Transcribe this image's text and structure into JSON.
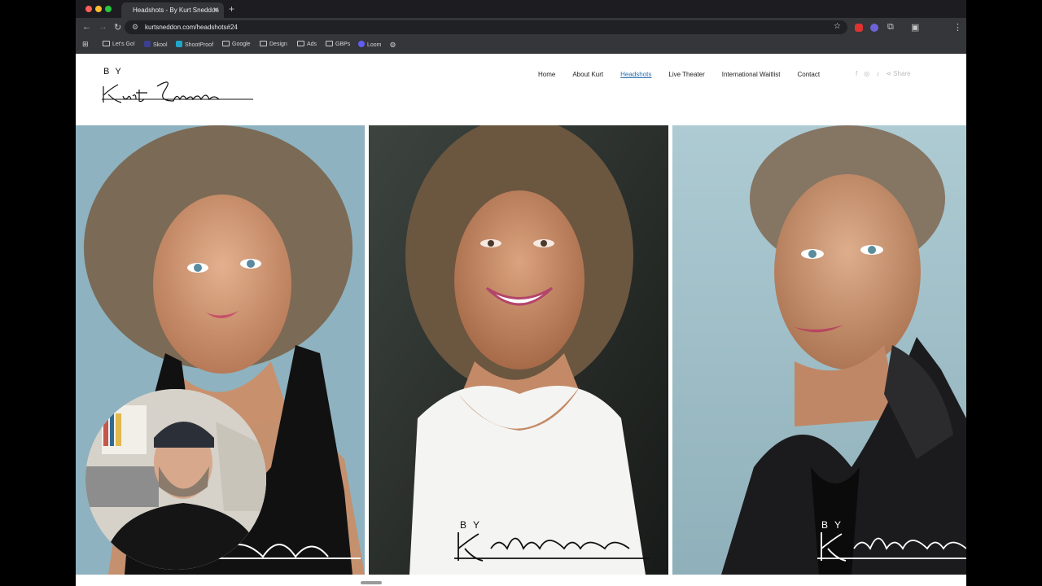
{
  "browser": {
    "tab_title": "Headshots - By Kurt Sneddon",
    "tab_close": "✕",
    "new_tab": "+",
    "url": "kurtsneddon.com/headshots#24",
    "bookmarks": [
      {
        "label": "Let's Go!",
        "type": "folder"
      },
      {
        "label": "Skool",
        "type": "site",
        "color": "#3b3f8f"
      },
      {
        "label": "ShootProof",
        "type": "site",
        "color": "#1fa7c9"
      },
      {
        "label": "Google",
        "type": "folder"
      },
      {
        "label": "Design",
        "type": "folder"
      },
      {
        "label": "Ads",
        "type": "folder"
      },
      {
        "label": "GBPs",
        "type": "folder"
      },
      {
        "label": "Loom",
        "type": "site",
        "color": "#625df5"
      }
    ],
    "icons": {
      "back": "arrow-left-icon",
      "forward": "arrow-right-icon",
      "reload": "reload-icon",
      "star": "star-icon",
      "apps": "grid-icon",
      "menu": "kebab-menu-icon"
    }
  },
  "site": {
    "logo_by": "BY",
    "logo_signature": "Kurt Sneddon",
    "nav": [
      {
        "label": "Home",
        "active": false
      },
      {
        "label": "About Kurt",
        "active": false
      },
      {
        "label": "Headshots",
        "active": true
      },
      {
        "label": "Live Theater",
        "active": false
      },
      {
        "label": "International Waitlist",
        "active": false
      },
      {
        "label": "Contact",
        "active": false
      }
    ],
    "social": {
      "facebook": "f",
      "instagram": "◎",
      "tiktok": "♪",
      "share": "Share"
    },
    "accent": "#2a6fb0"
  },
  "gallery": {
    "watermark_by": "BY",
    "watermark_signature": "Kurt Sneddon"
  }
}
